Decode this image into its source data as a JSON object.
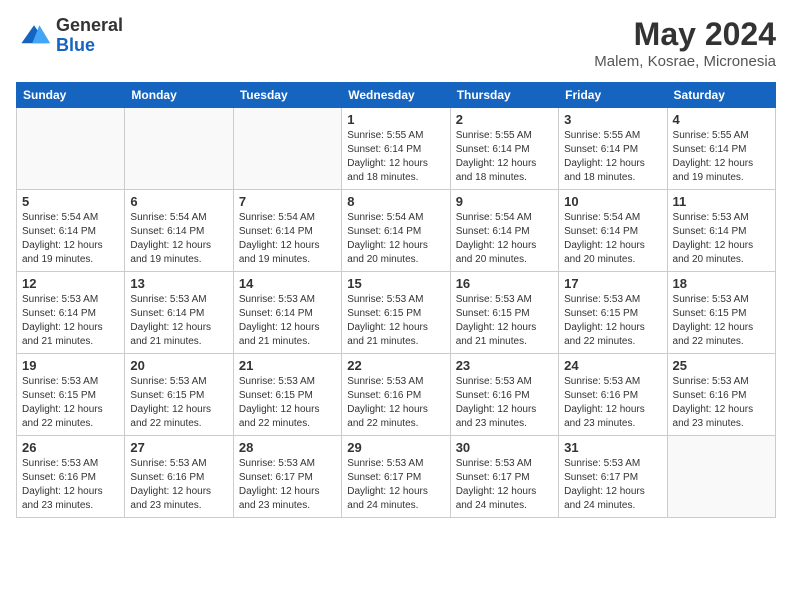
{
  "header": {
    "logo": {
      "general": "General",
      "blue": "Blue"
    },
    "month_year": "May 2024",
    "location": "Malem, Kosrae, Micronesia"
  },
  "weekdays": [
    "Sunday",
    "Monday",
    "Tuesday",
    "Wednesday",
    "Thursday",
    "Friday",
    "Saturday"
  ],
  "weeks": [
    [
      {
        "day": "",
        "info": ""
      },
      {
        "day": "",
        "info": ""
      },
      {
        "day": "",
        "info": ""
      },
      {
        "day": "1",
        "info": "Sunrise: 5:55 AM\nSunset: 6:14 PM\nDaylight: 12 hours\nand 18 minutes."
      },
      {
        "day": "2",
        "info": "Sunrise: 5:55 AM\nSunset: 6:14 PM\nDaylight: 12 hours\nand 18 minutes."
      },
      {
        "day": "3",
        "info": "Sunrise: 5:55 AM\nSunset: 6:14 PM\nDaylight: 12 hours\nand 18 minutes."
      },
      {
        "day": "4",
        "info": "Sunrise: 5:55 AM\nSunset: 6:14 PM\nDaylight: 12 hours\nand 19 minutes."
      }
    ],
    [
      {
        "day": "5",
        "info": "Sunrise: 5:54 AM\nSunset: 6:14 PM\nDaylight: 12 hours\nand 19 minutes."
      },
      {
        "day": "6",
        "info": "Sunrise: 5:54 AM\nSunset: 6:14 PM\nDaylight: 12 hours\nand 19 minutes."
      },
      {
        "day": "7",
        "info": "Sunrise: 5:54 AM\nSunset: 6:14 PM\nDaylight: 12 hours\nand 19 minutes."
      },
      {
        "day": "8",
        "info": "Sunrise: 5:54 AM\nSunset: 6:14 PM\nDaylight: 12 hours\nand 20 minutes."
      },
      {
        "day": "9",
        "info": "Sunrise: 5:54 AM\nSunset: 6:14 PM\nDaylight: 12 hours\nand 20 minutes."
      },
      {
        "day": "10",
        "info": "Sunrise: 5:54 AM\nSunset: 6:14 PM\nDaylight: 12 hours\nand 20 minutes."
      },
      {
        "day": "11",
        "info": "Sunrise: 5:53 AM\nSunset: 6:14 PM\nDaylight: 12 hours\nand 20 minutes."
      }
    ],
    [
      {
        "day": "12",
        "info": "Sunrise: 5:53 AM\nSunset: 6:14 PM\nDaylight: 12 hours\nand 21 minutes."
      },
      {
        "day": "13",
        "info": "Sunrise: 5:53 AM\nSunset: 6:14 PM\nDaylight: 12 hours\nand 21 minutes."
      },
      {
        "day": "14",
        "info": "Sunrise: 5:53 AM\nSunset: 6:14 PM\nDaylight: 12 hours\nand 21 minutes."
      },
      {
        "day": "15",
        "info": "Sunrise: 5:53 AM\nSunset: 6:15 PM\nDaylight: 12 hours\nand 21 minutes."
      },
      {
        "day": "16",
        "info": "Sunrise: 5:53 AM\nSunset: 6:15 PM\nDaylight: 12 hours\nand 21 minutes."
      },
      {
        "day": "17",
        "info": "Sunrise: 5:53 AM\nSunset: 6:15 PM\nDaylight: 12 hours\nand 22 minutes."
      },
      {
        "day": "18",
        "info": "Sunrise: 5:53 AM\nSunset: 6:15 PM\nDaylight: 12 hours\nand 22 minutes."
      }
    ],
    [
      {
        "day": "19",
        "info": "Sunrise: 5:53 AM\nSunset: 6:15 PM\nDaylight: 12 hours\nand 22 minutes."
      },
      {
        "day": "20",
        "info": "Sunrise: 5:53 AM\nSunset: 6:15 PM\nDaylight: 12 hours\nand 22 minutes."
      },
      {
        "day": "21",
        "info": "Sunrise: 5:53 AM\nSunset: 6:15 PM\nDaylight: 12 hours\nand 22 minutes."
      },
      {
        "day": "22",
        "info": "Sunrise: 5:53 AM\nSunset: 6:16 PM\nDaylight: 12 hours\nand 22 minutes."
      },
      {
        "day": "23",
        "info": "Sunrise: 5:53 AM\nSunset: 6:16 PM\nDaylight: 12 hours\nand 23 minutes."
      },
      {
        "day": "24",
        "info": "Sunrise: 5:53 AM\nSunset: 6:16 PM\nDaylight: 12 hours\nand 23 minutes."
      },
      {
        "day": "25",
        "info": "Sunrise: 5:53 AM\nSunset: 6:16 PM\nDaylight: 12 hours\nand 23 minutes."
      }
    ],
    [
      {
        "day": "26",
        "info": "Sunrise: 5:53 AM\nSunset: 6:16 PM\nDaylight: 12 hours\nand 23 minutes."
      },
      {
        "day": "27",
        "info": "Sunrise: 5:53 AM\nSunset: 6:16 PM\nDaylight: 12 hours\nand 23 minutes."
      },
      {
        "day": "28",
        "info": "Sunrise: 5:53 AM\nSunset: 6:17 PM\nDaylight: 12 hours\nand 23 minutes."
      },
      {
        "day": "29",
        "info": "Sunrise: 5:53 AM\nSunset: 6:17 PM\nDaylight: 12 hours\nand 24 minutes."
      },
      {
        "day": "30",
        "info": "Sunrise: 5:53 AM\nSunset: 6:17 PM\nDaylight: 12 hours\nand 24 minutes."
      },
      {
        "day": "31",
        "info": "Sunrise: 5:53 AM\nSunset: 6:17 PM\nDaylight: 12 hours\nand 24 minutes."
      },
      {
        "day": "",
        "info": ""
      }
    ]
  ]
}
